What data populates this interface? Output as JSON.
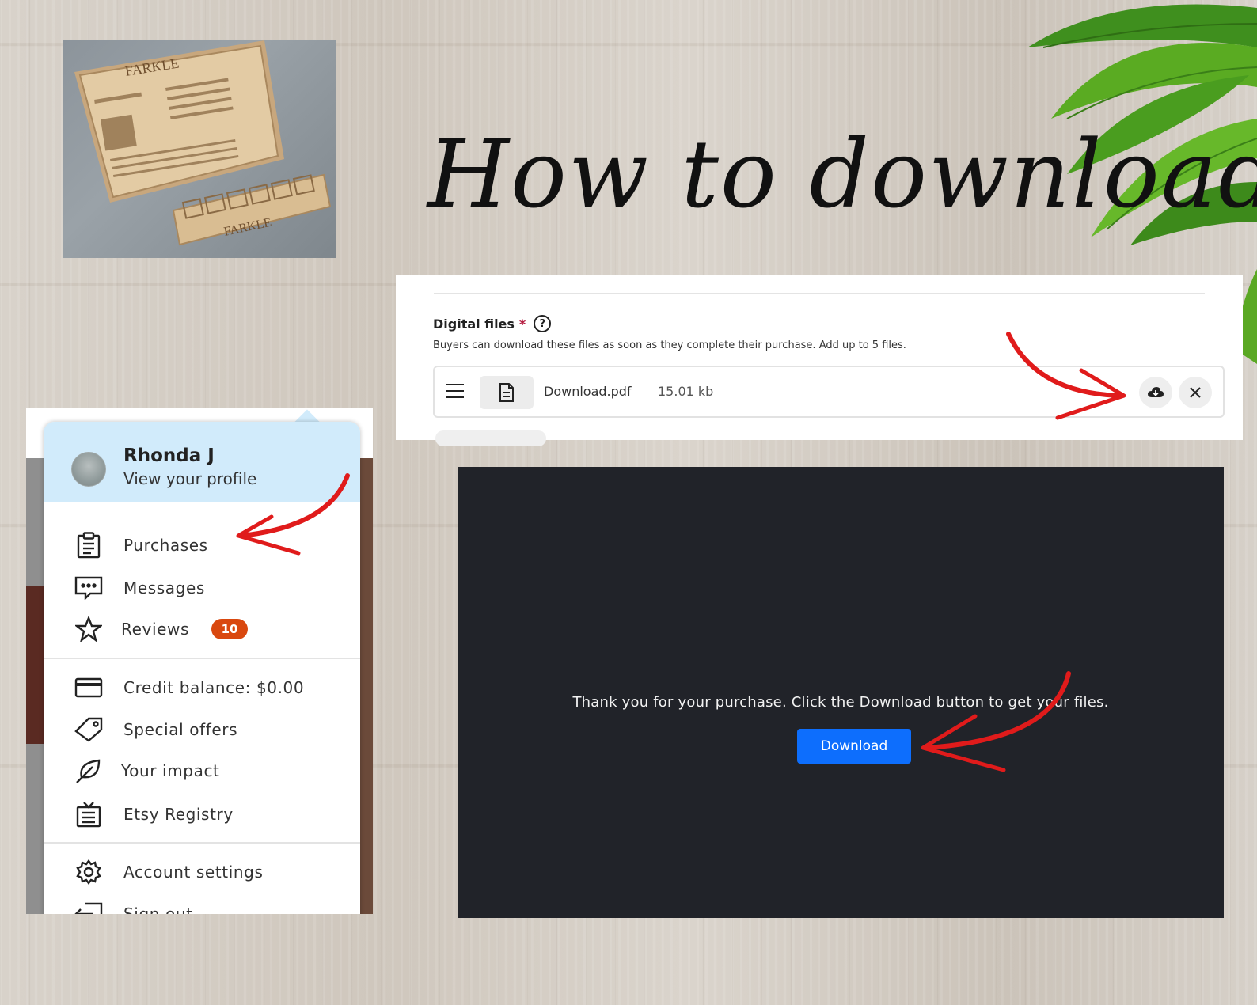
{
  "title": "How to download",
  "product_photo": {
    "board_title": "FARKLE",
    "tray_title": "FARKLE"
  },
  "digital_files": {
    "heading": "Digital files",
    "required_mark": "*",
    "help_icon": "question-circle-icon",
    "description": "Buyers can download these files as soon as they complete their purchase. Add up to 5 files.",
    "file": {
      "name": "Download.pdf",
      "size": "15.01 kb",
      "icons": [
        "drag-handle-icon",
        "document-icon",
        "cloud-download-icon",
        "close-icon"
      ]
    }
  },
  "account_menu": {
    "user_name": "Rhonda J",
    "profile_link": "View your profile",
    "items": [
      {
        "label": "Purchases",
        "icon": "clipboard-icon"
      },
      {
        "label": "Messages",
        "icon": "chat-bubble-icon"
      },
      {
        "label": "Reviews",
        "icon": "star-icon",
        "badge": "10"
      },
      {
        "label": "Credit balance: $0.00",
        "icon": "credit-card-icon"
      },
      {
        "label": "Special offers",
        "icon": "tag-icon"
      },
      {
        "label": "Your impact",
        "icon": "leaf-icon"
      },
      {
        "label": "Etsy Registry",
        "icon": "gift-registry-icon"
      },
      {
        "label": "Account settings",
        "icon": "gear-icon"
      },
      {
        "label": "Sign out",
        "icon": "sign-out-icon"
      }
    ]
  },
  "download_page": {
    "message": "Thank you for your purchase. Click the Download button to get your files.",
    "button_label": "Download"
  },
  "colors": {
    "arrow": "#e01b1b",
    "menu_header": "#d1ebfb",
    "badge": "#d9480f",
    "download_button": "#0d6efd",
    "dark_panel": "#212329"
  }
}
